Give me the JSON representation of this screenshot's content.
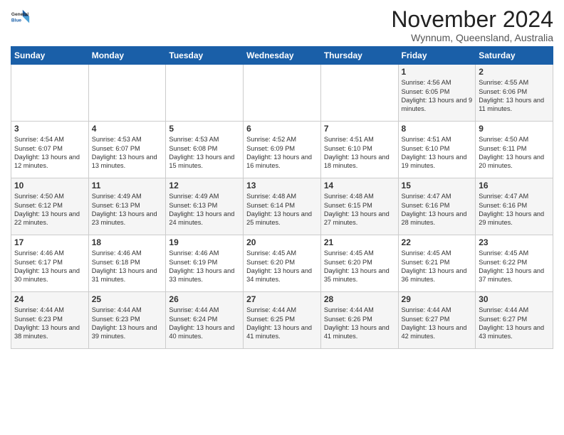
{
  "logo": {
    "line1": "General",
    "line2": "Blue"
  },
  "title": "November 2024",
  "subtitle": "Wynnum, Queensland, Australia",
  "days_header": [
    "Sunday",
    "Monday",
    "Tuesday",
    "Wednesday",
    "Thursday",
    "Friday",
    "Saturday"
  ],
  "weeks": [
    [
      {
        "num": "",
        "info": ""
      },
      {
        "num": "",
        "info": ""
      },
      {
        "num": "",
        "info": ""
      },
      {
        "num": "",
        "info": ""
      },
      {
        "num": "",
        "info": ""
      },
      {
        "num": "1",
        "info": "Sunrise: 4:56 AM\nSunset: 6:05 PM\nDaylight: 13 hours\nand 9 minutes."
      },
      {
        "num": "2",
        "info": "Sunrise: 4:55 AM\nSunset: 6:06 PM\nDaylight: 13 hours\nand 11 minutes."
      }
    ],
    [
      {
        "num": "3",
        "info": "Sunrise: 4:54 AM\nSunset: 6:07 PM\nDaylight: 13 hours\nand 12 minutes."
      },
      {
        "num": "4",
        "info": "Sunrise: 4:53 AM\nSunset: 6:07 PM\nDaylight: 13 hours\nand 13 minutes."
      },
      {
        "num": "5",
        "info": "Sunrise: 4:53 AM\nSunset: 6:08 PM\nDaylight: 13 hours\nand 15 minutes."
      },
      {
        "num": "6",
        "info": "Sunrise: 4:52 AM\nSunset: 6:09 PM\nDaylight: 13 hours\nand 16 minutes."
      },
      {
        "num": "7",
        "info": "Sunrise: 4:51 AM\nSunset: 6:10 PM\nDaylight: 13 hours\nand 18 minutes."
      },
      {
        "num": "8",
        "info": "Sunrise: 4:51 AM\nSunset: 6:10 PM\nDaylight: 13 hours\nand 19 minutes."
      },
      {
        "num": "9",
        "info": "Sunrise: 4:50 AM\nSunset: 6:11 PM\nDaylight: 13 hours\nand 20 minutes."
      }
    ],
    [
      {
        "num": "10",
        "info": "Sunrise: 4:50 AM\nSunset: 6:12 PM\nDaylight: 13 hours\nand 22 minutes."
      },
      {
        "num": "11",
        "info": "Sunrise: 4:49 AM\nSunset: 6:13 PM\nDaylight: 13 hours\nand 23 minutes."
      },
      {
        "num": "12",
        "info": "Sunrise: 4:49 AM\nSunset: 6:13 PM\nDaylight: 13 hours\nand 24 minutes."
      },
      {
        "num": "13",
        "info": "Sunrise: 4:48 AM\nSunset: 6:14 PM\nDaylight: 13 hours\nand 25 minutes."
      },
      {
        "num": "14",
        "info": "Sunrise: 4:48 AM\nSunset: 6:15 PM\nDaylight: 13 hours\nand 27 minutes."
      },
      {
        "num": "15",
        "info": "Sunrise: 4:47 AM\nSunset: 6:16 PM\nDaylight: 13 hours\nand 28 minutes."
      },
      {
        "num": "16",
        "info": "Sunrise: 4:47 AM\nSunset: 6:16 PM\nDaylight: 13 hours\nand 29 minutes."
      }
    ],
    [
      {
        "num": "17",
        "info": "Sunrise: 4:46 AM\nSunset: 6:17 PM\nDaylight: 13 hours\nand 30 minutes."
      },
      {
        "num": "18",
        "info": "Sunrise: 4:46 AM\nSunset: 6:18 PM\nDaylight: 13 hours\nand 31 minutes."
      },
      {
        "num": "19",
        "info": "Sunrise: 4:46 AM\nSunset: 6:19 PM\nDaylight: 13 hours\nand 33 minutes."
      },
      {
        "num": "20",
        "info": "Sunrise: 4:45 AM\nSunset: 6:20 PM\nDaylight: 13 hours\nand 34 minutes."
      },
      {
        "num": "21",
        "info": "Sunrise: 4:45 AM\nSunset: 6:20 PM\nDaylight: 13 hours\nand 35 minutes."
      },
      {
        "num": "22",
        "info": "Sunrise: 4:45 AM\nSunset: 6:21 PM\nDaylight: 13 hours\nand 36 minutes."
      },
      {
        "num": "23",
        "info": "Sunrise: 4:45 AM\nSunset: 6:22 PM\nDaylight: 13 hours\nand 37 minutes."
      }
    ],
    [
      {
        "num": "24",
        "info": "Sunrise: 4:44 AM\nSunset: 6:23 PM\nDaylight: 13 hours\nand 38 minutes."
      },
      {
        "num": "25",
        "info": "Sunrise: 4:44 AM\nSunset: 6:23 PM\nDaylight: 13 hours\nand 39 minutes."
      },
      {
        "num": "26",
        "info": "Sunrise: 4:44 AM\nSunset: 6:24 PM\nDaylight: 13 hours\nand 40 minutes."
      },
      {
        "num": "27",
        "info": "Sunrise: 4:44 AM\nSunset: 6:25 PM\nDaylight: 13 hours\nand 41 minutes."
      },
      {
        "num": "28",
        "info": "Sunrise: 4:44 AM\nSunset: 6:26 PM\nDaylight: 13 hours\nand 41 minutes."
      },
      {
        "num": "29",
        "info": "Sunrise: 4:44 AM\nSunset: 6:27 PM\nDaylight: 13 hours\nand 42 minutes."
      },
      {
        "num": "30",
        "info": "Sunrise: 4:44 AM\nSunset: 6:27 PM\nDaylight: 13 hours\nand 43 minutes."
      }
    ]
  ]
}
